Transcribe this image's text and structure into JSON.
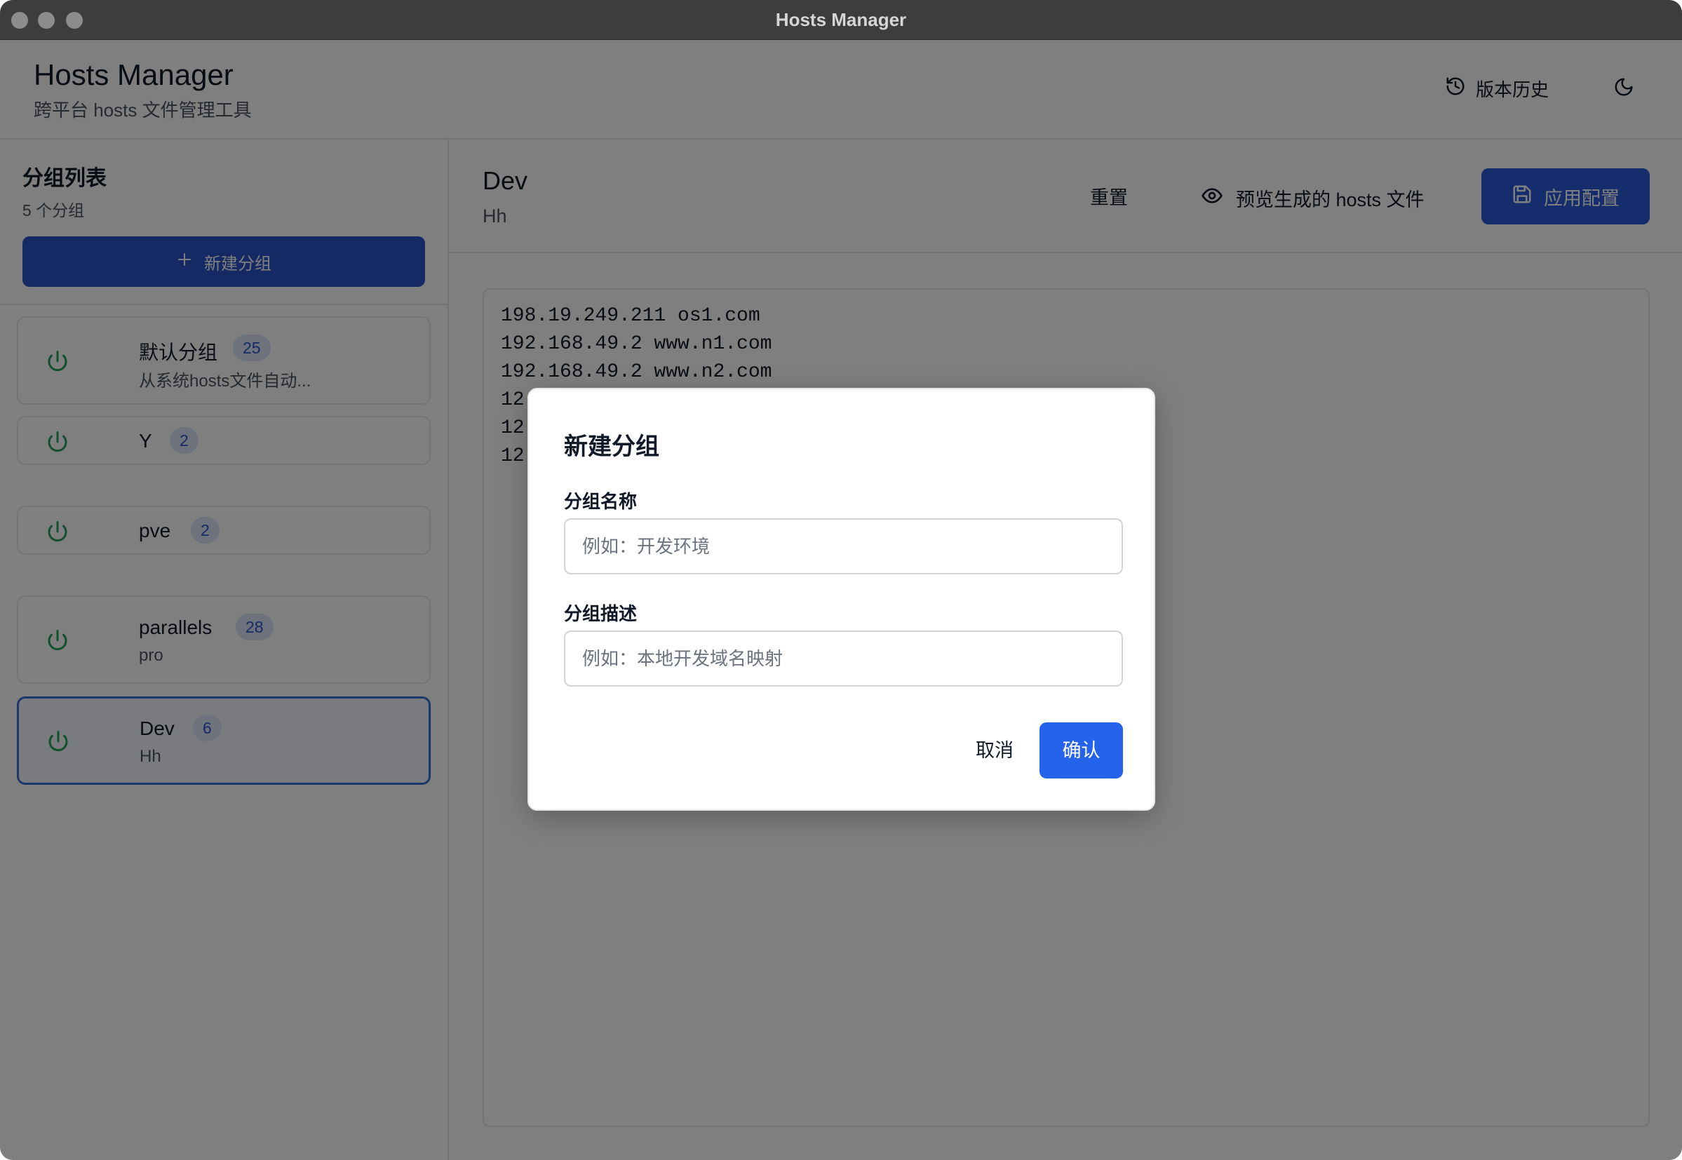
{
  "window": {
    "title": "Hosts Manager"
  },
  "header": {
    "title": "Hosts Manager",
    "subtitle": "跨平台 hosts 文件管理工具",
    "history_label": "版本历史",
    "history_icon": "history-icon",
    "theme_icon": "moon-icon"
  },
  "sidebar": {
    "title": "分组列表",
    "count": "5 个分组",
    "new_group_label": "新建分组",
    "groups": [
      {
        "name": "默认分组",
        "count": "25",
        "desc": "从系统hosts文件自动...",
        "enabled": true,
        "active": false
      },
      {
        "name": "Y",
        "count": "2",
        "desc": "",
        "enabled": true,
        "active": false
      },
      {
        "name": "pve",
        "count": "2",
        "desc": "",
        "enabled": true,
        "active": false
      },
      {
        "name": "parallels",
        "count": "28",
        "desc": "pro",
        "enabled": true,
        "active": false
      },
      {
        "name": "Dev",
        "count": "6",
        "desc": "Hh",
        "enabled": true,
        "active": true
      }
    ]
  },
  "main": {
    "title": "Dev",
    "subtitle": "Hh",
    "reset_label": "重置",
    "preview_label": "预览生成的 hosts 文件",
    "apply_label": "应用配置",
    "editor_lines": [
      "198.19.249.211 os1.com",
      "192.168.49.2 www.n1.com",
      "192.168.49.2 www.n2.com",
      "12",
      "12",
      "12"
    ]
  },
  "dialog": {
    "title": "新建分组",
    "name_label": "分组名称",
    "name_placeholder": "例如：开发环境",
    "name_value": "",
    "desc_label": "分组描述",
    "desc_placeholder": "例如：本地开发域名映射",
    "desc_value": "",
    "cancel_label": "取消",
    "confirm_label": "确认"
  },
  "colors": {
    "primary": "#2563eb",
    "power_on": "#22a05a",
    "badge_bg": "#dbe5fb",
    "overlay": "rgba(0,0,0,0.5)"
  }
}
